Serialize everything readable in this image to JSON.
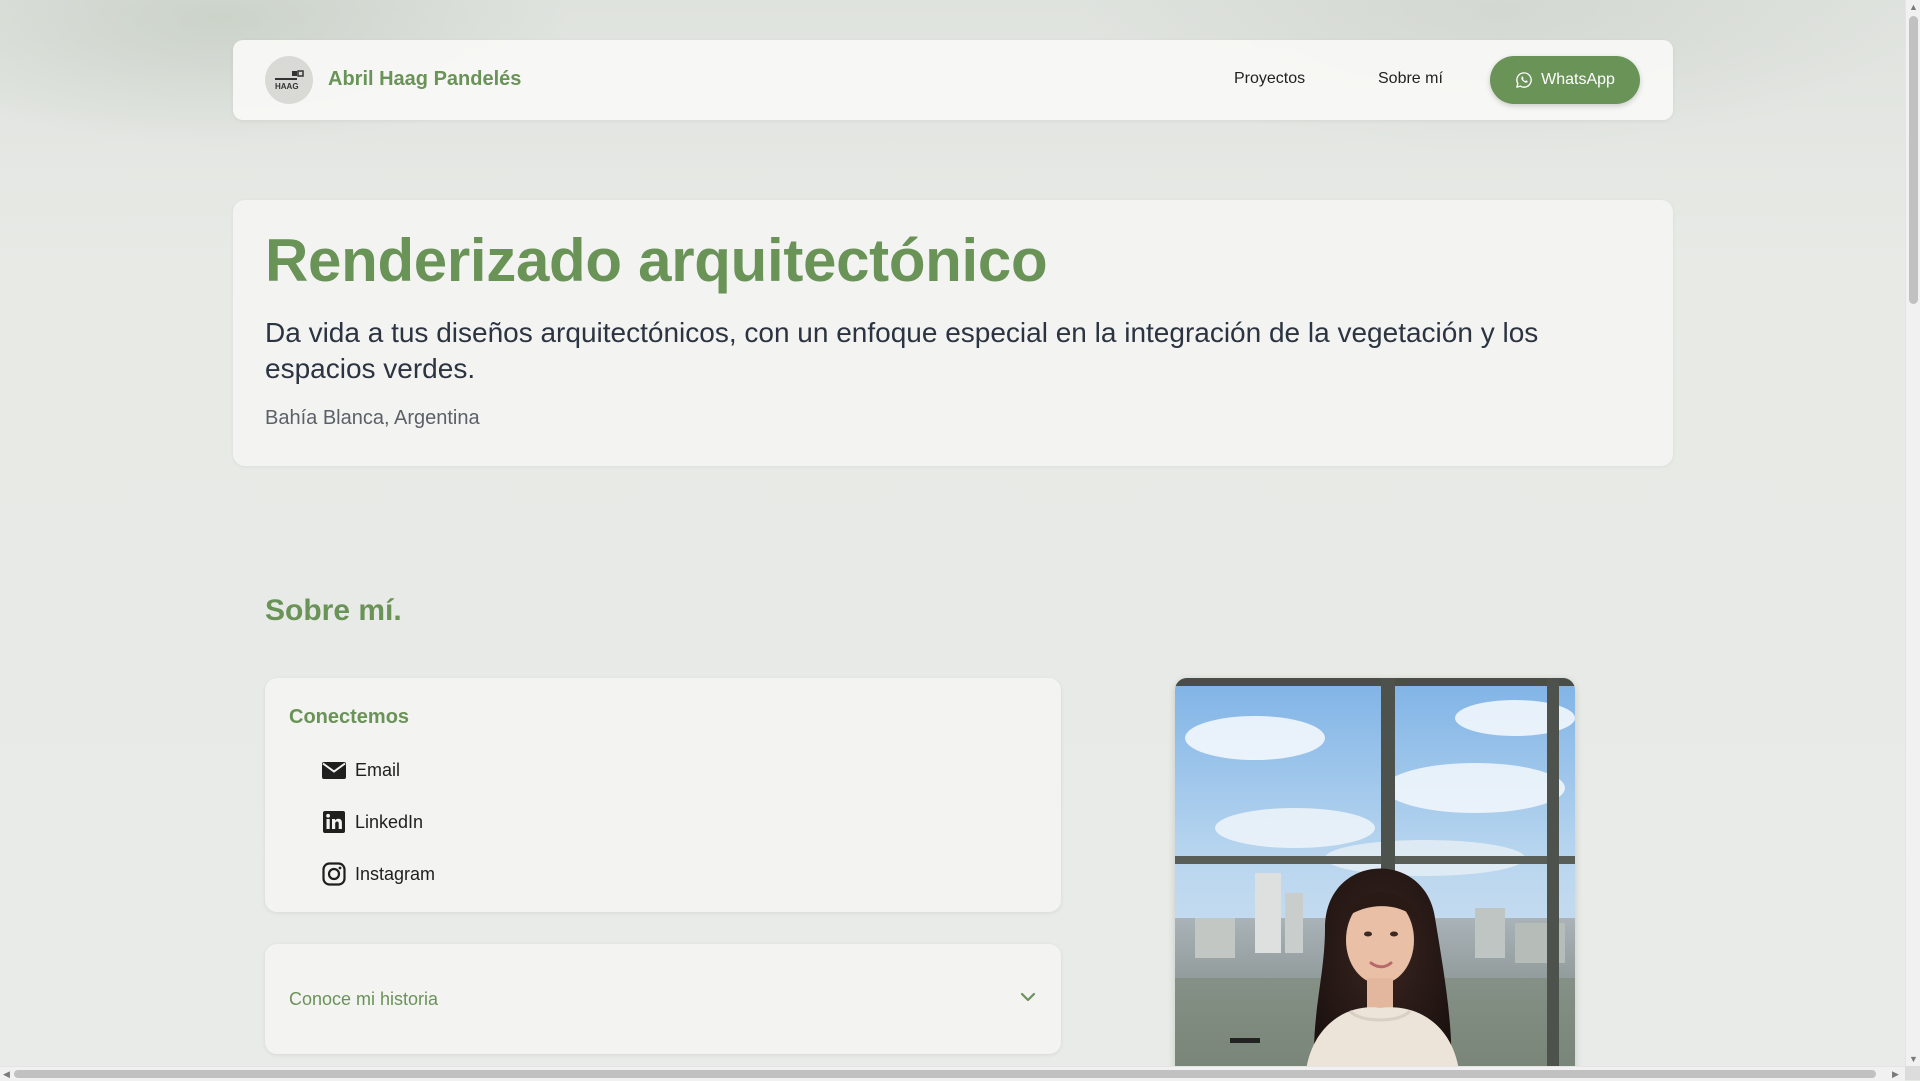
{
  "nav": {
    "brand": "Abril Haag Pandelés",
    "logo_text": "HAAG",
    "links": [
      {
        "label": "Proyectos"
      },
      {
        "label": "Sobre mí"
      }
    ],
    "whatsapp_label": "WhatsApp"
  },
  "hero": {
    "title": "Renderizado arquitectónico",
    "subtitle": "Da vida a tus diseños arquitectónicos, con un enfoque especial en la integración de la vegetación y los espacios verdes.",
    "location": "Bahía Blanca, Argentina"
  },
  "about": {
    "title": "Sobre mí.",
    "connect": {
      "heading": "Conectemos",
      "items": [
        {
          "label": "Email",
          "icon": "envelope-icon"
        },
        {
          "label": "LinkedIn",
          "icon": "linkedin-icon"
        },
        {
          "label": "Instagram",
          "icon": "instagram-icon"
        }
      ]
    },
    "story": {
      "label": "Conoce mi historia",
      "icon": "chevron-down-icon"
    }
  },
  "colors": {
    "accent": "#6a9358",
    "text_dark": "#2b3440",
    "card_bg": "#f3f3f2"
  }
}
